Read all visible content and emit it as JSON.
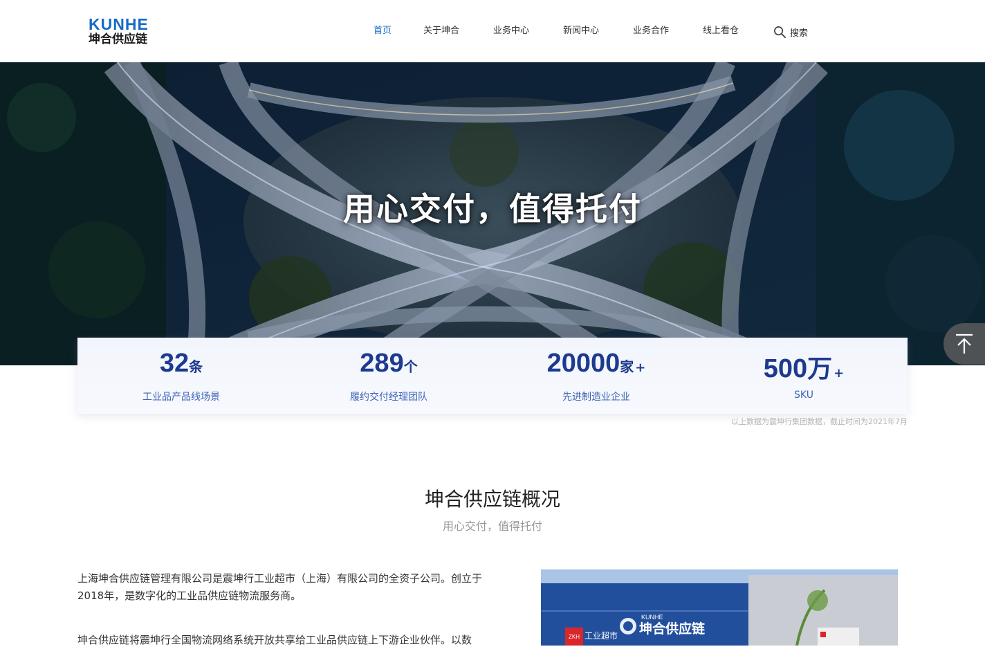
{
  "header": {
    "logo_en": "KUNHE",
    "logo_cn": "坤合供应链",
    "nav": [
      {
        "label": "首页",
        "active": true
      },
      {
        "label": "关于坤合",
        "active": false
      },
      {
        "label": "业务中心",
        "active": false
      },
      {
        "label": "新闻中心",
        "active": false
      },
      {
        "label": "业务合作",
        "active": false
      },
      {
        "label": "线上看仓",
        "active": false
      }
    ],
    "search_label": "搜索"
  },
  "hero": {
    "title": "用心交付，值得托付",
    "slides": 2,
    "active_slide": 2
  },
  "stats": [
    {
      "number": "32",
      "unit": "条",
      "plus": "",
      "label": "工业品产品线场景"
    },
    {
      "number": "289",
      "unit": "个",
      "plus": "",
      "label": "履约交付经理团队"
    },
    {
      "number": "20000",
      "unit": "家",
      "plus": "+",
      "label": "先进制造业企业"
    },
    {
      "number": "500",
      "unit": "万",
      "plus": "+",
      "label": "SKU"
    }
  ],
  "stats_note": "以上数据为震坤行集团数据，截止时间为2021年7月",
  "overview": {
    "title": "坤合供应链概况",
    "subtitle": "用心交付，值得托付",
    "para1": "上海坤合供应链管理有限公司是震坤行工业超市（上海）有限公司的全资子公司。创立于2018年，是数字化的工业品供应链物流服务商。",
    "para2": "坤合供应链将震坤行全国物流网络系统开放共享给工业品供应链上下游企业伙伴。以数",
    "photo_sign_en": "KUNHE",
    "photo_sign_cn": "坤合供应链",
    "photo_store": "工业超市",
    "photo_badge": "ZKH"
  },
  "colors": {
    "brand": "#1769c7",
    "stat_number": "#1d3a8f",
    "stat_label": "#3d63b8"
  }
}
